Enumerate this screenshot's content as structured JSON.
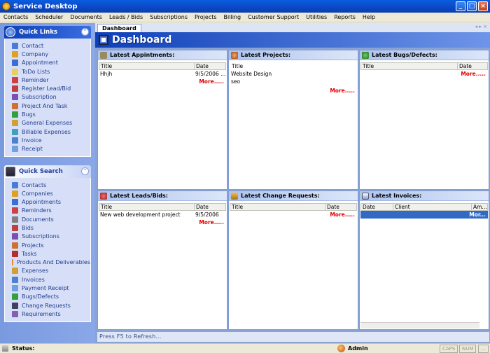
{
  "window": {
    "title": "Service Desktop"
  },
  "menu": [
    "Contacts",
    "Scheduler",
    "Documents",
    "Leads / Bids",
    "Subscriptions",
    "Projects",
    "Billing",
    "Customer Support",
    "Utilities",
    "Reports",
    "Help"
  ],
  "quick_links": {
    "title": "Quick Links",
    "items": [
      {
        "label": "Contact",
        "icon": "contact-icon",
        "color": "#4a7bd6"
      },
      {
        "label": "Company",
        "icon": "company-icon",
        "color": "#e0a020"
      },
      {
        "label": "Appointment",
        "icon": "appointment-icon",
        "color": "#3b6fd0"
      },
      {
        "label": "ToDo Lists",
        "icon": "todo-icon",
        "color": "#e8d060"
      },
      {
        "label": "Reminder",
        "icon": "reminder-icon",
        "color": "#d04040"
      },
      {
        "label": "Register  Lead/Bid",
        "icon": "lead-icon",
        "color": "#c04040"
      },
      {
        "label": "Subscription",
        "icon": "subscription-icon",
        "color": "#7a50b0"
      },
      {
        "label": "Project And Task",
        "icon": "project-icon",
        "color": "#d07030"
      },
      {
        "label": "Bugs",
        "icon": "bug-icon",
        "color": "#30a040"
      },
      {
        "label": "General Expenses",
        "icon": "expense-icon",
        "color": "#d0a030"
      },
      {
        "label": "Billable Expenses",
        "icon": "billable-icon",
        "color": "#40a0c0"
      },
      {
        "label": "Invoice",
        "icon": "invoice-icon",
        "color": "#5080d0"
      },
      {
        "label": "Receipt",
        "icon": "receipt-icon",
        "color": "#70a0e0"
      }
    ]
  },
  "quick_search": {
    "title": "Quick Search",
    "items": [
      {
        "label": "Contacts",
        "icon": "contacts-search-icon",
        "color": "#4a7bd6"
      },
      {
        "label": "Companies",
        "icon": "companies-search-icon",
        "color": "#e0a020"
      },
      {
        "label": "Appointments",
        "icon": "appointments-search-icon",
        "color": "#3b6fd0"
      },
      {
        "label": "Reminders",
        "icon": "reminders-search-icon",
        "color": "#d04040"
      },
      {
        "label": "Documents",
        "icon": "documents-search-icon",
        "color": "#808080"
      },
      {
        "label": "Bids",
        "icon": "bids-search-icon",
        "color": "#c04040"
      },
      {
        "label": "Subscriptions",
        "icon": "subscriptions-search-icon",
        "color": "#7a50b0"
      },
      {
        "label": "Projects",
        "icon": "projects-search-icon",
        "color": "#d07030"
      },
      {
        "label": "Tasks",
        "icon": "tasks-search-icon",
        "color": "#b03030"
      },
      {
        "label": "Products And Deliverables",
        "icon": "products-search-icon",
        "color": "#e09030"
      },
      {
        "label": "Expenses",
        "icon": "expenses-search-icon",
        "color": "#d0a030"
      },
      {
        "label": "Invoices",
        "icon": "invoices-search-icon",
        "color": "#5080d0"
      },
      {
        "label": "Payment Receipt",
        "icon": "payment-search-icon",
        "color": "#70a0e0"
      },
      {
        "label": "Bugs/Defects",
        "icon": "bugs-search-icon",
        "color": "#30a040"
      },
      {
        "label": "Change Requests",
        "icon": "change-search-icon",
        "color": "#404060"
      },
      {
        "label": "Requirements",
        "icon": "requirements-search-icon",
        "color": "#8060b0"
      }
    ]
  },
  "tab": {
    "label": "Dashboard",
    "nav": "◂ ▸ ×"
  },
  "dashboard": {
    "title": "Dashboard"
  },
  "panels": {
    "appointments": {
      "title": "Latest Appintments:",
      "col1": "Title",
      "col2": "Date",
      "rows": [
        [
          "Hhjh",
          "9/5/2006 ..."
        ]
      ],
      "more": "More....."
    },
    "projects": {
      "title": "Latest Projects:",
      "col1": "Title",
      "rows": [
        [
          "Website Design"
        ],
        [
          "seo"
        ]
      ],
      "more": "More....."
    },
    "bugs": {
      "title": "Latest Bugs/Defects:",
      "col1": "Title",
      "col2": "Date",
      "rows": [],
      "more": "More....."
    },
    "leads": {
      "title": "Latest Leads/Bids:",
      "col1": "Title",
      "col2": "Date",
      "rows": [
        [
          "New web development project",
          "9/5/2006"
        ]
      ],
      "more": "More....."
    },
    "changes": {
      "title": "Latest Change Requests:",
      "col1": "Title",
      "col2": "Date",
      "rows": [],
      "more": "More....."
    },
    "invoices": {
      "title": "Latest Invoices:",
      "col1": "Date",
      "col2": "Client",
      "col3": "Am...",
      "more": "Mor..."
    }
  },
  "footer_hint": "Press F5 to Refresh...",
  "status": {
    "label": "Status:",
    "user": "Admin",
    "caps": "CAPS",
    "num": "NUM",
    "extra": "..."
  },
  "colors": {
    "accent": "#0d3fb8",
    "more": "#e00000",
    "selection": "#316ac5"
  }
}
